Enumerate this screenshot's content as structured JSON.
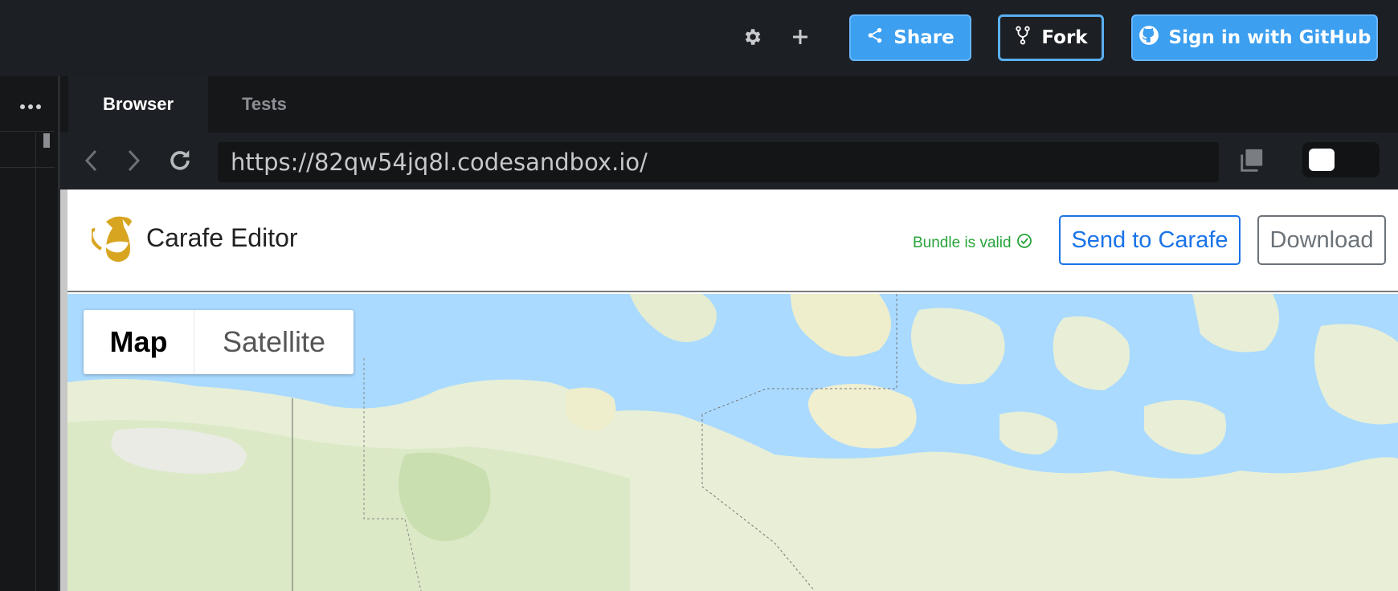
{
  "toolbar": {
    "share_label": "Share",
    "fork_label": "Fork",
    "github_label": "Sign in with GitHub",
    "icons": [
      "gear-icon",
      "plus-icon",
      "share-icon",
      "fork-icon",
      "github-icon"
    ]
  },
  "tabs": [
    {
      "label": "Browser",
      "active": true
    },
    {
      "label": "Tests",
      "active": false
    }
  ],
  "browser": {
    "url": "https://82qw54jq8l.codesandbox.io/"
  },
  "app": {
    "title": "Carafe Editor",
    "bundle_status": "Bundle is valid",
    "send_label": "Send to Carafe",
    "download_label": "Download"
  },
  "map": {
    "types": [
      {
        "label": "Map",
        "selected": true
      },
      {
        "label": "Satellite",
        "selected": false
      }
    ]
  },
  "colors": {
    "accent": "#3c9ff0",
    "success": "#26a43a",
    "link_blue": "#1a73e8",
    "water": "#aadaff",
    "land": "#e8f0d8"
  }
}
